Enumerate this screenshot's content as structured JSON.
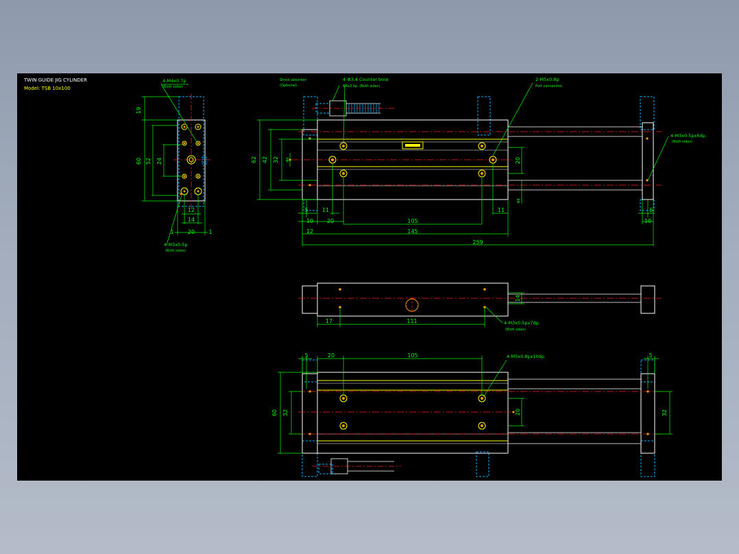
{
  "title": "TWIN GUIDE JIG CYLINDER",
  "model": "Model: TSB 10x100",
  "colors": {
    "background": "#000000",
    "outline": "#ffffff",
    "dimension": "#00ff00",
    "hidden": "#00b0ff",
    "center": "#ff2020",
    "highlight": "#ffff00",
    "hole": "#ff9900"
  },
  "side_view": {
    "callout_top": "4-M4x0.7p",
    "callout_top_sub": "(Both sides)",
    "callout_bottom": "4-M3x0.5p",
    "callout_bottom_sub": "(Both sides)",
    "dims": {
      "d19": "19",
      "d60": "60",
      "d52": "52",
      "d24": "24",
      "d12": "12",
      "d14": "14",
      "d20": "20",
      "d1a": "1",
      "d1b": "1"
    }
  },
  "front_view": {
    "callout_shock": "Shock absorber",
    "callout_shock_sub": "(Optional)",
    "callout_counter": "4-Φ3.4 Counter bore",
    "callout_counter_sub": "Φ6x3.5p. (Both sides)",
    "callout_port": "2-M5x0.8p",
    "callout_port_sub": "Port connection",
    "callout_rod": "4-M3x0.5px6dp.",
    "callout_rod_sub": "(Both sides)",
    "dims": {
      "d62": "62",
      "d42": "42",
      "d32": "32",
      "d6": "Φ6",
      "d20v": "20",
      "d8": "Φ8",
      "d5l": "5",
      "d10l": "10",
      "d11l": "11",
      "d20h": "20",
      "d105": "105",
      "d11r": "11",
      "d5r": "5",
      "d10r": "10",
      "d12": "12",
      "d145": "145",
      "d259": "259"
    }
  },
  "middle_view": {
    "callout": "4-M3x0.5px7dp.",
    "callout_sub": "(Both sides)",
    "dims": {
      "d14": "14",
      "d17": "17",
      "d111": "111"
    }
  },
  "bottom_view": {
    "callout": "4-M5x0.8px10dp.",
    "dims": {
      "d5l": "5",
      "d20": "20",
      "d105": "105",
      "d5r": "5",
      "d60": "60",
      "d32l": "32",
      "d20v": "20",
      "d32r": "32"
    }
  }
}
